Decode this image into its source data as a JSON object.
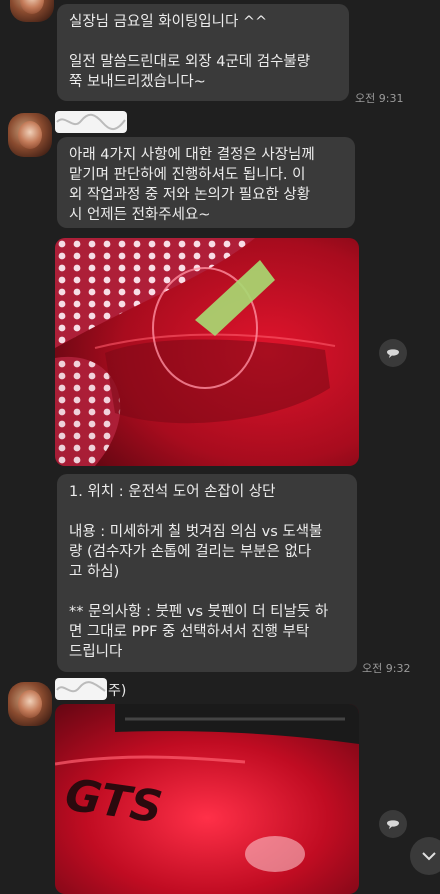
{
  "messages": {
    "msg1": {
      "text": "실장님 금요일 화이팅입니다 ^^\n\n일전 말씀드린대로 외장 4군데 검수불량\n쭉 보내드리겠습니다~",
      "time": "오전 9:31"
    },
    "msg2": {
      "text": "아래 4가지 사항에 대한 결정은 사장님께\n맡기며 판단하에 진행하셔도 됩니다. 이\n외 작업과정 중 저와 논의가 필요한 상황\n시 언제든 전화주세요~"
    },
    "msg3": {
      "text": "1. 위치 : 운전석 도어 손잡이 상단\n\n내용 : 미세하게 칠 벗겨짐 의심 vs 도색불\n량 (검수자가 손톱에 걸리는 부분은 없다\n고 하심)\n\n** 문의사항 : 붓펜 vs 붓펜이 더 티날듯 하\n면 그대로 PPF 중 선택하셔서 진행 부탁\n드립니다",
      "time": "오전 9:32"
    }
  },
  "senders": {
    "sender_a_suffix": "",
    "sender_b_suffix": "주)"
  },
  "icons": {
    "share": "chat-share-icon",
    "scroll": "chevron-down-icon"
  },
  "colors": {
    "background": "#1f1f1f",
    "bubble": "#3a3a3a",
    "car_red": "#c8102e"
  }
}
